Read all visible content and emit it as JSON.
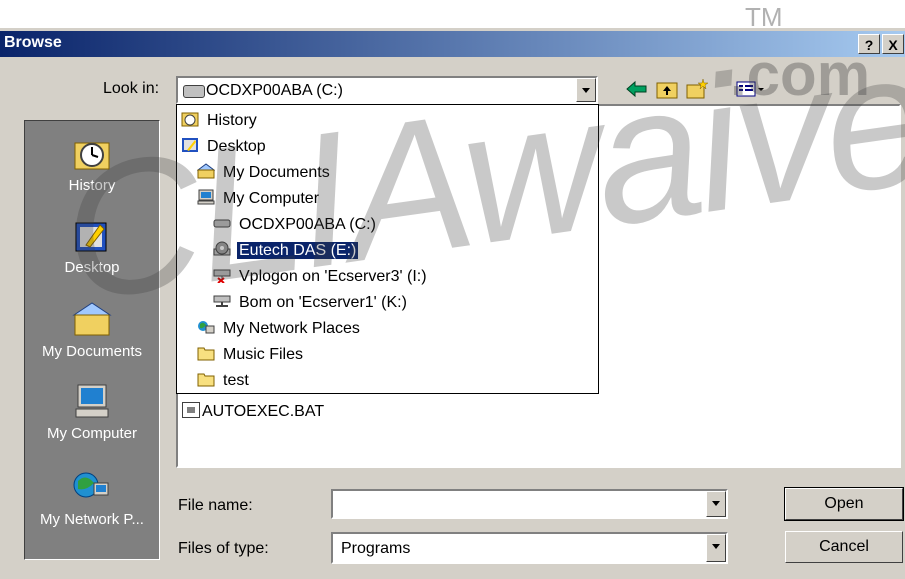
{
  "dialog": {
    "title": "Browse",
    "help_button": "?",
    "close_button": "X"
  },
  "look_in": {
    "label": "Look in:",
    "value": "OCDXP00ABA (C:)"
  },
  "places": [
    {
      "label": "History",
      "icon": "history-icon"
    },
    {
      "label": "Desktop",
      "icon": "desktop-icon"
    },
    {
      "label": "My Documents",
      "icon": "my-documents-icon"
    },
    {
      "label": "My Computer",
      "icon": "my-computer-icon"
    },
    {
      "label": "My Network P...",
      "icon": "network-places-icon"
    }
  ],
  "look_in_dropdown": {
    "items": [
      {
        "label": "History",
        "icon": "history-icon",
        "selected": false
      },
      {
        "label": "Desktop",
        "icon": "desktop-icon",
        "selected": false
      },
      {
        "label": "My Documents",
        "icon": "my-documents-icon",
        "selected": false
      },
      {
        "label": "My Computer",
        "icon": "my-computer-icon",
        "selected": false
      },
      {
        "label": "OCDXP00ABA (C:)",
        "icon": "hard-drive-icon",
        "selected": false
      },
      {
        "label": "Eutech DAS (E:)",
        "icon": "cd-drive-icon",
        "selected": true
      },
      {
        "label": "Vplogon on 'Ecserver3' (I:)",
        "icon": "disconnected-network-drive-icon",
        "selected": false
      },
      {
        "label": "Bom on 'Ecserver1' (K:)",
        "icon": "network-drive-icon",
        "selected": false
      },
      {
        "label": "My Network Places",
        "icon": "network-places-icon",
        "selected": false
      },
      {
        "label": "Music Files",
        "icon": "folder-icon",
        "selected": false
      },
      {
        "label": "test",
        "icon": "folder-icon",
        "selected": false
      }
    ]
  },
  "file_list": {
    "items": [
      {
        "label": "AUTOEXEC.BAT",
        "icon": "batch-file-icon"
      }
    ]
  },
  "file_name": {
    "label": "File name:",
    "value": ""
  },
  "files_of_type": {
    "label": "Files of type:",
    "value": "Programs"
  },
  "buttons": {
    "open": "Open",
    "cancel": "Cancel"
  },
  "watermark": {
    "text": "CLIAwaived",
    "suffix": ".com",
    "mark": "TM"
  }
}
